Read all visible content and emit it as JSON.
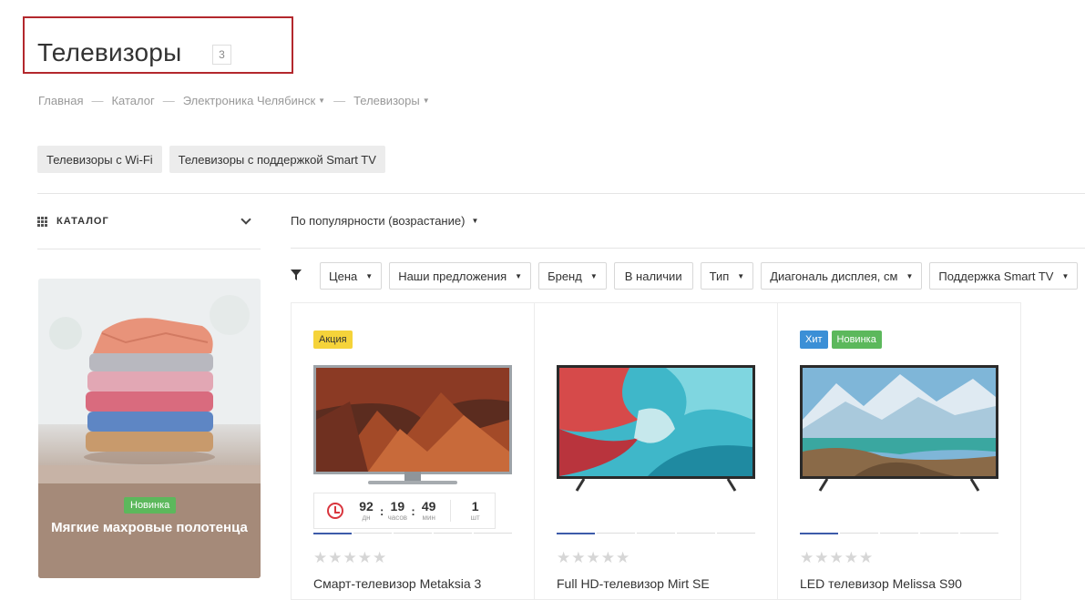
{
  "page": {
    "title": "Телевизоры",
    "count": "3"
  },
  "breadcrumb": [
    {
      "label": "Главная",
      "has_dropdown": false
    },
    {
      "label": "Каталог",
      "has_dropdown": false
    },
    {
      "label": "Электроника Челябинск",
      "has_dropdown": true
    },
    {
      "label": "Телевизоры",
      "has_dropdown": true
    }
  ],
  "breadcrumb_separator": "—",
  "chips": [
    "Телевизоры с Wi-Fi",
    "Телевизоры с поддержкой Smart TV"
  ],
  "sidebar": {
    "catalog_label": "КАТАЛОГ",
    "promo": {
      "badge": "Новинка",
      "title": "Мягкие махровые полотенца"
    }
  },
  "sort": {
    "selected": "По популярности (возрастание)"
  },
  "filters": [
    {
      "label": "Цена",
      "dropdown": true
    },
    {
      "label": "Наши предложения",
      "dropdown": true
    },
    {
      "label": "Бренд",
      "dropdown": true
    },
    {
      "label": "В наличии",
      "dropdown": false
    },
    {
      "label": "Тип",
      "dropdown": true
    },
    {
      "label": "Диагональ дисплея, см",
      "dropdown": true
    },
    {
      "label": "Поддержка Smart TV",
      "dropdown": true
    }
  ],
  "products": [
    {
      "name": "Смарт-телевизор Metaksia 3",
      "badges": [
        {
          "label": "Акция",
          "color": "#f5d33a",
          "text_color": "#333333"
        }
      ],
      "timer": {
        "days": "92",
        "days_label": "дн",
        "hours": "19",
        "hours_label": "часов",
        "minutes": "49",
        "minutes_label": "мин",
        "qty": "1",
        "qty_label": "шт"
      },
      "rating": 0,
      "active_image_fraction": 0.2
    },
    {
      "name": "Full HD-телевизор Mirt SE",
      "badges": [],
      "rating": 0,
      "active_image_fraction": 0.2
    },
    {
      "name": "LED телевизор Melissa S90",
      "badges": [
        {
          "label": "Хит",
          "color": "#3b8fd6",
          "text_color": "#ffffff"
        },
        {
          "label": "Новинка",
          "color": "#5cb85c",
          "text_color": "#ffffff"
        }
      ],
      "rating": 0,
      "active_image_fraction": 0.2
    }
  ],
  "icons": {
    "catalog": "grid-dots-icon",
    "chevron": "chevron-down-icon",
    "filter": "funnel-icon",
    "timer": "clock-icon",
    "star": "star-icon"
  },
  "colors": {
    "highlight_border": "#b3282d",
    "accent": "#3d5ba9",
    "timer_icon": "#d9363e"
  }
}
